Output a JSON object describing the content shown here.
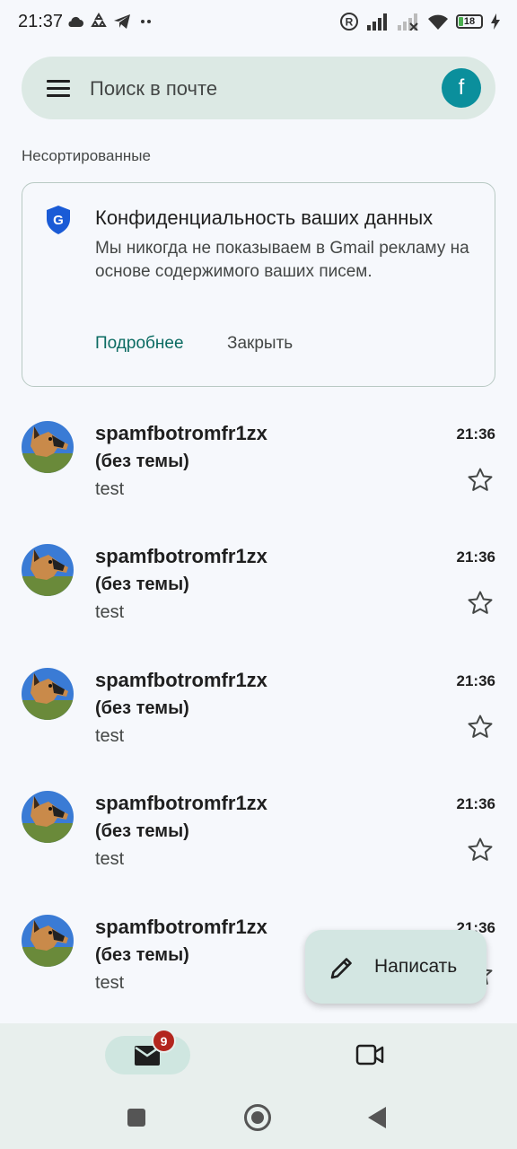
{
  "status_bar": {
    "time": "21:37",
    "battery": "18",
    "icons": [
      "cloud-icon",
      "recycle-icon",
      "telegram-icon",
      "more-dots-icon",
      "registered-icon",
      "signal-icon",
      "signal-off-icon",
      "wifi-icon",
      "battery-icon",
      "charging-icon"
    ]
  },
  "search": {
    "placeholder": "Поиск в почте",
    "avatar_letter": "f"
  },
  "section_label": "Несортированные",
  "privacy_card": {
    "title": "Конфиденциальность ваших данных",
    "body": "Мы никогда не показываем в Gmail рекламу на основе содержимого ваших писем.",
    "more_label": "Подробнее",
    "close_label": "Закрыть"
  },
  "emails": [
    {
      "sender": "spamfbotromfr1zx",
      "subject": "(без темы)",
      "snippet": "test",
      "time": "21:36"
    },
    {
      "sender": "spamfbotromfr1zx",
      "subject": "(без темы)",
      "snippet": "test",
      "time": "21:36"
    },
    {
      "sender": "spamfbotromfr1zx",
      "subject": "(без темы)",
      "snippet": "test",
      "time": "21:36"
    },
    {
      "sender": "spamfbotromfr1zx",
      "subject": "(без темы)",
      "snippet": "test",
      "time": "21:36"
    },
    {
      "sender": "spamfbotromfr1zx",
      "subject": "(без темы)",
      "snippet": "test",
      "time": "21:36"
    }
  ],
  "compose": {
    "label": "Написать"
  },
  "bottom_nav": {
    "mail_badge": "9"
  },
  "colors": {
    "accent": "#0b6b62",
    "search_bg": "#dce9e4",
    "avatar_bg": "#0b8f9c",
    "badge": "#b3261e"
  }
}
